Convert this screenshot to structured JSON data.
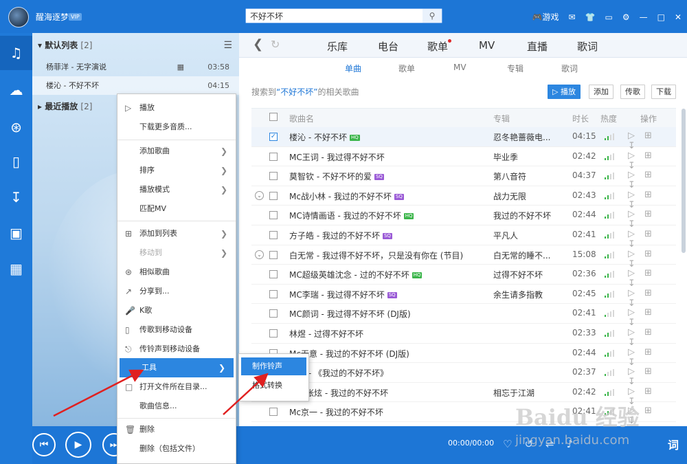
{
  "titlebar": {
    "username": "醒海逐梦",
    "vip_badge": "VIP",
    "search_value": "不好不坏",
    "games_label": "游戏"
  },
  "playlist": {
    "default_list_label": "默认列表",
    "default_list_count": "[2]",
    "items": [
      {
        "title": "杨菲洋 - 无字演说",
        "time": "03:58"
      },
      {
        "title": "楼沁 - 不好不坏",
        "time": "04:15"
      }
    ],
    "recent_label": "最近播放",
    "recent_count": "[2]"
  },
  "nav": {
    "tabs": [
      "乐库",
      "电台",
      "歌单",
      "MV",
      "直播",
      "歌词"
    ],
    "subtabs": [
      "单曲",
      "歌单",
      "MV",
      "专辑",
      "歌词"
    ]
  },
  "results": {
    "prefix": "搜索到",
    "query": "“不好不坏”",
    "suffix": "的相关歌曲",
    "btn_play": "播放",
    "btn_add": "添加",
    "btn_send": "传歌",
    "btn_download": "下载"
  },
  "table": {
    "headers": {
      "name": "歌曲名",
      "album": "专辑",
      "duration": "时长",
      "heat": "热度",
      "ops": "操作"
    },
    "rows": [
      {
        "name": "楼沁 - 不好不坏",
        "badge": "HQ",
        "album": "忍冬艳蔷薇电...",
        "dur": "04:15",
        "checked": true,
        "expand": false
      },
      {
        "name": "MC王词 - 我过得不好不坏",
        "badge": "",
        "album": "毕业季",
        "dur": "02:42",
        "checked": false,
        "expand": false
      },
      {
        "name": "莫智钦 - 不好不坏的爱",
        "badge": "SQ",
        "album": "第八音符",
        "dur": "04:37",
        "checked": false,
        "expand": false
      },
      {
        "name": "Mc战小林 - 我过的不好不坏",
        "badge": "SQ",
        "album": "战力无限",
        "dur": "02:43",
        "checked": false,
        "expand": true
      },
      {
        "name": "MC诗情画语 - 我过的不好不坏",
        "badge": "HQ",
        "album": "我过的不好不坏",
        "dur": "02:44",
        "checked": false,
        "expand": false
      },
      {
        "name": "方子皓 - 我过的不好不坏",
        "badge": "SQ",
        "album": "平凡人",
        "dur": "02:41",
        "checked": false,
        "expand": false
      },
      {
        "name": "白无常 - 我过得不好不坏，只是没有你在 (节目)",
        "badge": "",
        "album": "白无常的睡不...",
        "dur": "15:08",
        "checked": false,
        "expand": true
      },
      {
        "name": "MC超级英雄沈念 - 过的不好不坏",
        "badge": "HQ",
        "album": "过得不好不坏",
        "dur": "02:36",
        "checked": false,
        "expand": false
      },
      {
        "name": "MC李瑞 - 我过得不好不坏",
        "badge": "SQ",
        "album": "余生请多指教",
        "dur": "02:45",
        "checked": false,
        "expand": false
      },
      {
        "name": "MC颜词 - 我过得不好不坏 (DJ版)",
        "badge": "",
        "album": "",
        "dur": "02:41",
        "checked": false,
        "expand": false
      },
      {
        "name": "林煜 - 过得不好不坏",
        "badge": "",
        "album": "",
        "dur": "02:33",
        "checked": false,
        "expand": false
      },
      {
        "name": "Mc无意 - 我过的不好不坏 (DJ版)",
        "badge": "",
        "album": "",
        "dur": "02:44",
        "checked": false,
        "expand": false
      },
      {
        "name": "歌者 - 《我过的不好不坏》",
        "badge": "",
        "album": "",
        "dur": "02:37",
        "checked": false,
        "expand": false
      },
      {
        "name": "战王张炫 - 我过的不好不坏",
        "badge": "",
        "album": "相忘于江湖",
        "dur": "02:42",
        "checked": false,
        "expand": false
      },
      {
        "name": "Mc京一 - 我过的不好不坏",
        "badge": "",
        "album": "",
        "dur": "02:41",
        "checked": false,
        "expand": false
      }
    ]
  },
  "context_menu": {
    "items": [
      "播放",
      "下载更多音质...",
      "添加歌曲",
      "排序",
      "播放模式",
      "匹配MV",
      "添加到列表",
      "移动到",
      "相似歌曲",
      "分享到...",
      "K歌",
      "传歌到移动设备",
      "传铃声到移动设备",
      "工具",
      "打开文件所在目录...",
      "歌曲信息...",
      "删除",
      "删除（包括文件）"
    ]
  },
  "submenu": {
    "items": [
      "制作铃声",
      "格式转换"
    ]
  },
  "player": {
    "time": "00:00/00:00",
    "lyric_label": "词"
  },
  "watermark": {
    "big": "Baidu 经验",
    "small": "jingyan.baidu.com"
  }
}
